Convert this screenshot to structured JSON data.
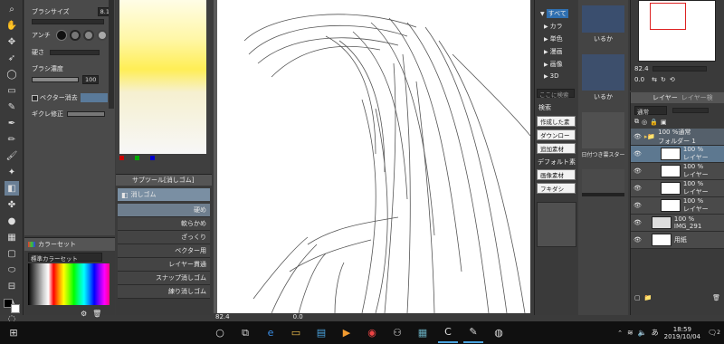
{
  "tool_property": {
    "brush_size_label": "ブラシサイズ",
    "brush_size_value": "8.1",
    "aa_label": "アンチ",
    "hardness_label": "硬さ",
    "density_label": "ブラシ濃度",
    "density_value": "100",
    "vector_erase_label": "ベクター消去",
    "tick_label": "ギクレ修正"
  },
  "subtool": {
    "tab_label": "サブツール[消しゴム]",
    "title": "消しゴム",
    "items": [
      {
        "label": "硬め"
      },
      {
        "label": "軟らかめ"
      },
      {
        "label": "ざっくり"
      },
      {
        "label": "ベクター用"
      },
      {
        "label": "レイヤー貫通"
      },
      {
        "label": "スナップ消しゴム"
      },
      {
        "label": "練り消しゴム"
      }
    ]
  },
  "colorset": {
    "tab_label": "カラーセット",
    "dropdown_value": "標準カラーセット"
  },
  "materials": {
    "root_label": "すべて",
    "tree_items": [
      "カラ",
      "単色",
      "漫画",
      "画像",
      "3D"
    ],
    "search_placeholder": "ここに検索",
    "tag_label": "検索",
    "buttons": [
      "作成した素",
      "ダウンロー",
      "追加素材",
      "デフォルト素",
      "画像素材",
      "フキダシ"
    ]
  },
  "navigator": {
    "label": "いるか",
    "label2": "いるか",
    "label3": "日付つき雲スター"
  },
  "layer": {
    "blend_mode": "通常",
    "opacity": "100",
    "tab_layer": "レイヤー",
    "tab_search": "レイヤー検",
    "rows": [
      {
        "percent": "100 %通常",
        "name": "フォルダー 1"
      },
      {
        "percent": "100 %",
        "name": "レイヤー"
      },
      {
        "percent": "100 %",
        "name": "レイヤー"
      },
      {
        "percent": "100 %",
        "name": "レイヤー"
      },
      {
        "percent": "100 %",
        "name": "レイヤー"
      },
      {
        "percent": "100 %",
        "name": "IMG_291"
      },
      {
        "percent": "",
        "name": "用紙"
      }
    ]
  },
  "canvas": {
    "zoom": "82.4",
    "rotation": "0.0",
    "nav_zoom": "82.4",
    "nav_rotate": "0.0"
  },
  "taskbar": {
    "time": "18:59",
    "date": "2019/10/04",
    "ime": "あ",
    "notify": "2"
  },
  "colors": {
    "accent": "#4aa3df",
    "chrome": "#4a4a4a",
    "dark": "#3a3a3a",
    "taskbar": "#101010"
  }
}
